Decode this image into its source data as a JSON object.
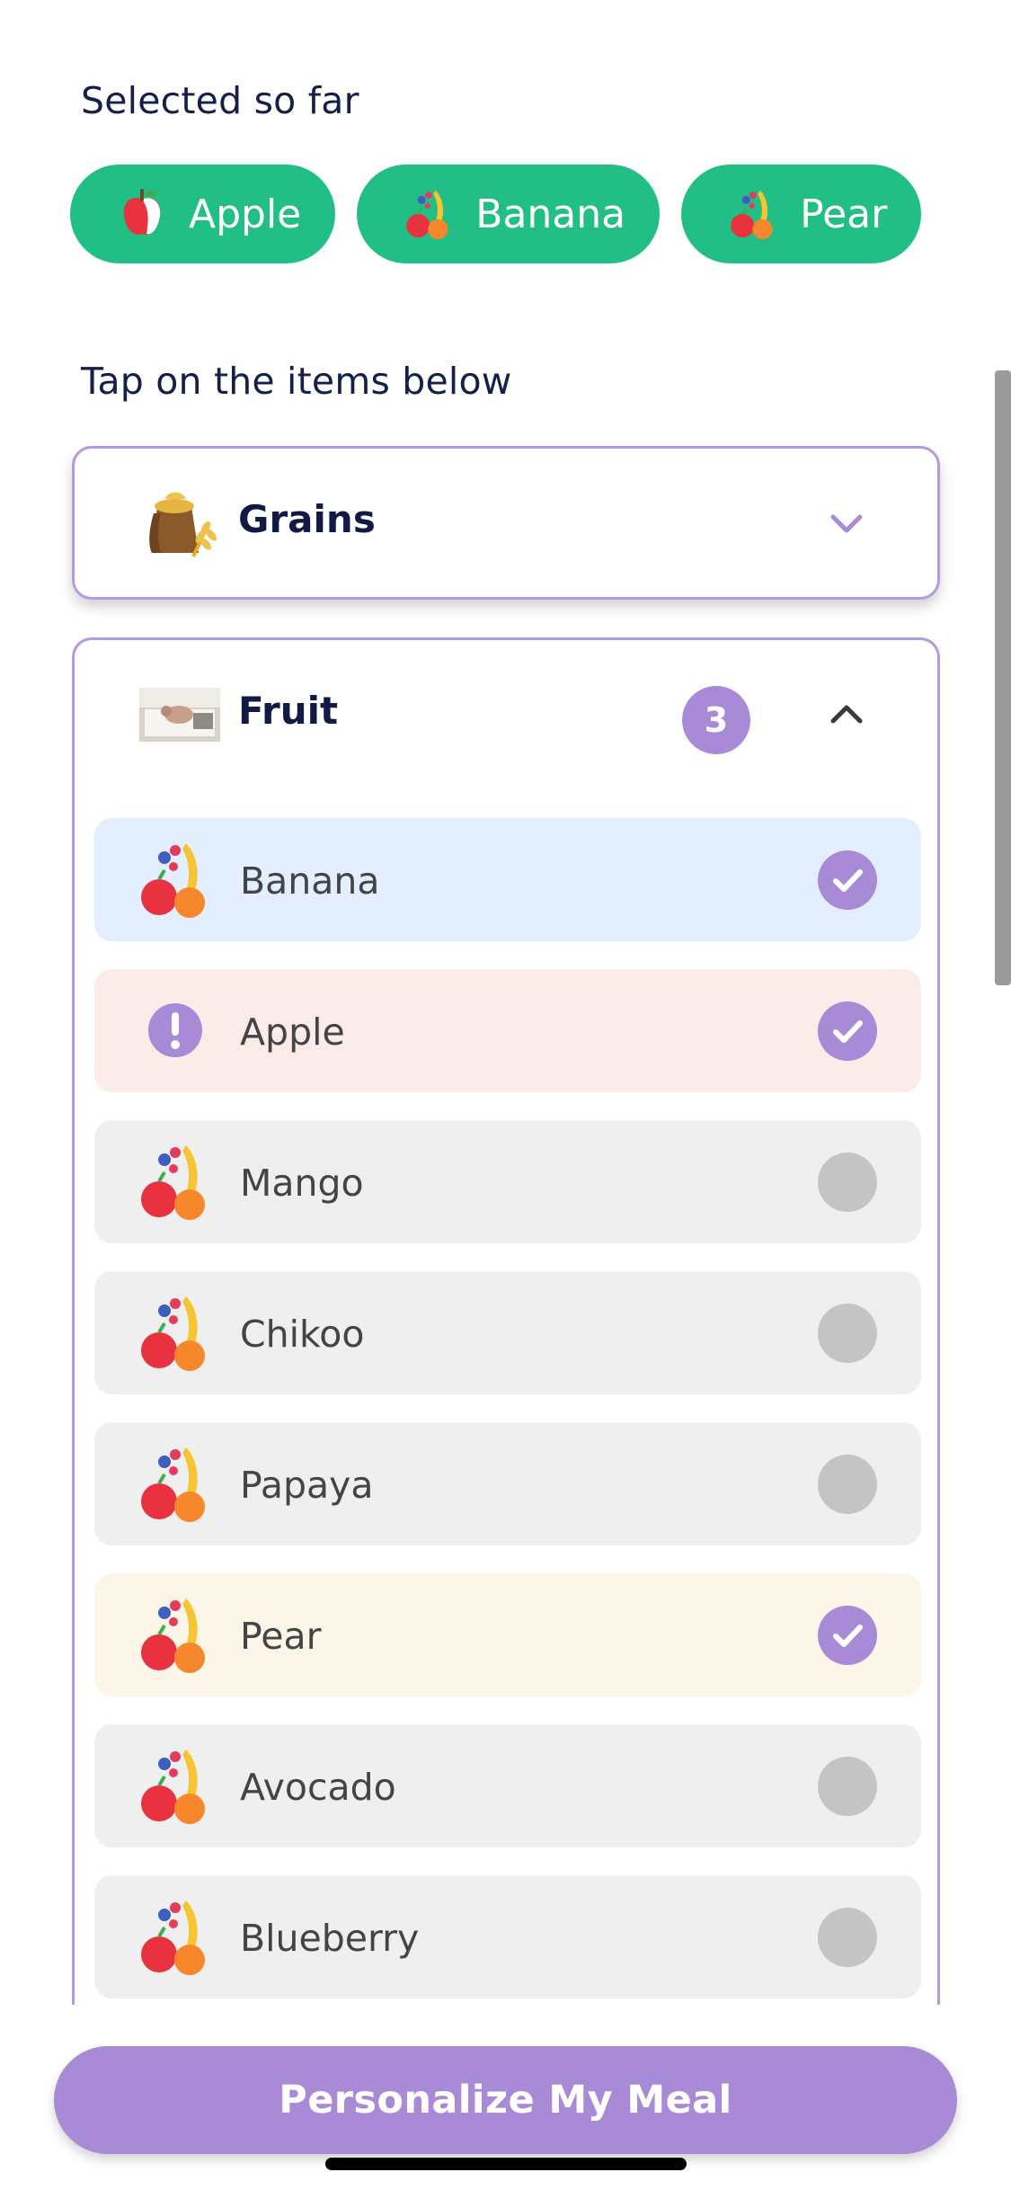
{
  "selected": {
    "label": "Selected so far",
    "chips": [
      {
        "label": "Apple",
        "icon": "apple-icon"
      },
      {
        "label": "Banana",
        "icon": "fruit-mix-icon"
      },
      {
        "label": "Pear",
        "icon": "fruit-mix-icon"
      }
    ]
  },
  "instructions": "Tap on the items below",
  "categories": {
    "grains": {
      "title": "Grains",
      "icon": "grain-sack-icon",
      "expanded": false
    },
    "fruit": {
      "title": "Fruit",
      "icon": "fruit-photo-icon",
      "count": "3",
      "expanded": true,
      "items": [
        {
          "label": "Banana",
          "selected": true,
          "state_color": "#e3efff",
          "icon": "fruit-mix-icon"
        },
        {
          "label": "Apple",
          "selected": true,
          "state_color": "#fbece9",
          "icon": "warning-icon"
        },
        {
          "label": "Mango",
          "selected": false,
          "state_color": "#efefef",
          "icon": "fruit-mix-icon"
        },
        {
          "label": "Chikoo",
          "selected": false,
          "state_color": "#efefef",
          "icon": "fruit-mix-icon"
        },
        {
          "label": "Papaya",
          "selected": false,
          "state_color": "#efefef",
          "icon": "fruit-mix-icon"
        },
        {
          "label": "Pear",
          "selected": true,
          "state_color": "#fbf6e7",
          "icon": "fruit-mix-icon"
        },
        {
          "label": "Avocado",
          "selected": false,
          "state_color": "#efefef",
          "icon": "fruit-mix-icon"
        },
        {
          "label": "Blueberry",
          "selected": false,
          "state_color": "#efefef",
          "icon": "fruit-mix-icon"
        }
      ]
    }
  },
  "cta": {
    "label": "Personalize My Meal"
  },
  "colors": {
    "accent": "#a98ad6",
    "chip": "#21bf86",
    "border": "#b49be0"
  }
}
